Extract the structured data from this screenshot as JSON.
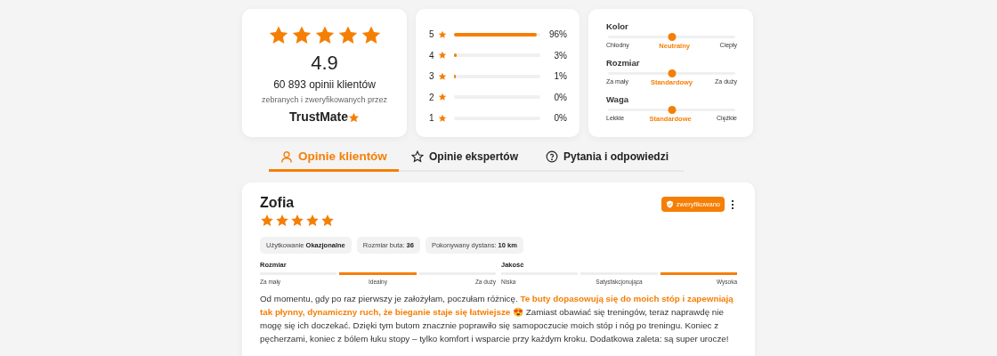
{
  "summary": {
    "stars": 5,
    "rating": "4.9",
    "count": "60 893 opinii klientów",
    "caption": "zebranych i zweryfikowanych przez",
    "brand": "TrustMate"
  },
  "distribution": [
    {
      "label": "5",
      "level": 0.96,
      "percent": "96%"
    },
    {
      "label": "4",
      "level": 0.03,
      "percent": "3%"
    },
    {
      "label": "3",
      "level": 0.01,
      "percent": "1%"
    },
    {
      "label": "2",
      "percent": "0%"
    },
    {
      "label": "1",
      "percent": "0%"
    }
  ],
  "attributes": [
    {
      "name": "Kolor",
      "level": 0.5,
      "min": "Chłodny",
      "value": "Neutralny",
      "max": "Ciepły"
    },
    {
      "name": "Rozmiar",
      "level": 0.5,
      "min": "Za mały",
      "value": "Standardowy",
      "max": "Za duży"
    },
    {
      "name": "Waga",
      "level": 0.5,
      "min": "Lekkie",
      "value": "Standardowe",
      "max": "Ciężkie"
    }
  ],
  "tabs": [
    {
      "label": "Opinie klientów",
      "selected": true
    },
    {
      "label": "Opinie ekspertów",
      "selected": false
    },
    {
      "label": "Pytania i odpowiedzi",
      "selected": false
    }
  ],
  "review": {
    "author": "Zofia",
    "stars": 5,
    "badge": "zweryfikowano",
    "tags": [
      {
        "label": "Użytkowanie",
        "value": "Okazjonalne"
      },
      {
        "label": "Rozmiar buta:",
        "value": "36"
      },
      {
        "label": "Pokonywany dystans:",
        "value": "10 km"
      }
    ],
    "scales": [
      {
        "title": "Rozmiar",
        "segments": [
          {
            "label": "Za mały",
            "selected": false
          },
          {
            "label": "Idealny",
            "selected": true
          },
          {
            "label": "Za duży",
            "selected": false
          }
        ]
      },
      {
        "title": "Jakość",
        "segments": [
          {
            "label": "Niska",
            "selected": false
          },
          {
            "label": "Satysfakcjonująca",
            "selected": false
          },
          {
            "label": "Wysoka",
            "selected": true
          }
        ]
      }
    ],
    "text": "Od momentu, gdy po raz pierwszy je założyłam, poczułam różnicę. **Te buty dopasowują się do moich stóp i zapewniają tak płynny, dynamiczny ruch, że bieganie staje się łatwiejsze** 😍 Zamiast obawiać się treningów, teraz naprawdę nie mogę się ich doczekać. Dzięki tym butom znacznie poprawiło się samopoczucie moich stóp i nóg po treningu. Koniec z pęcherzami, koniec z bólem łuku stopy – tylko komfort i wsparcie przy każdym kroku. Dodatkowa zaleta: są super urocze!"
  }
}
